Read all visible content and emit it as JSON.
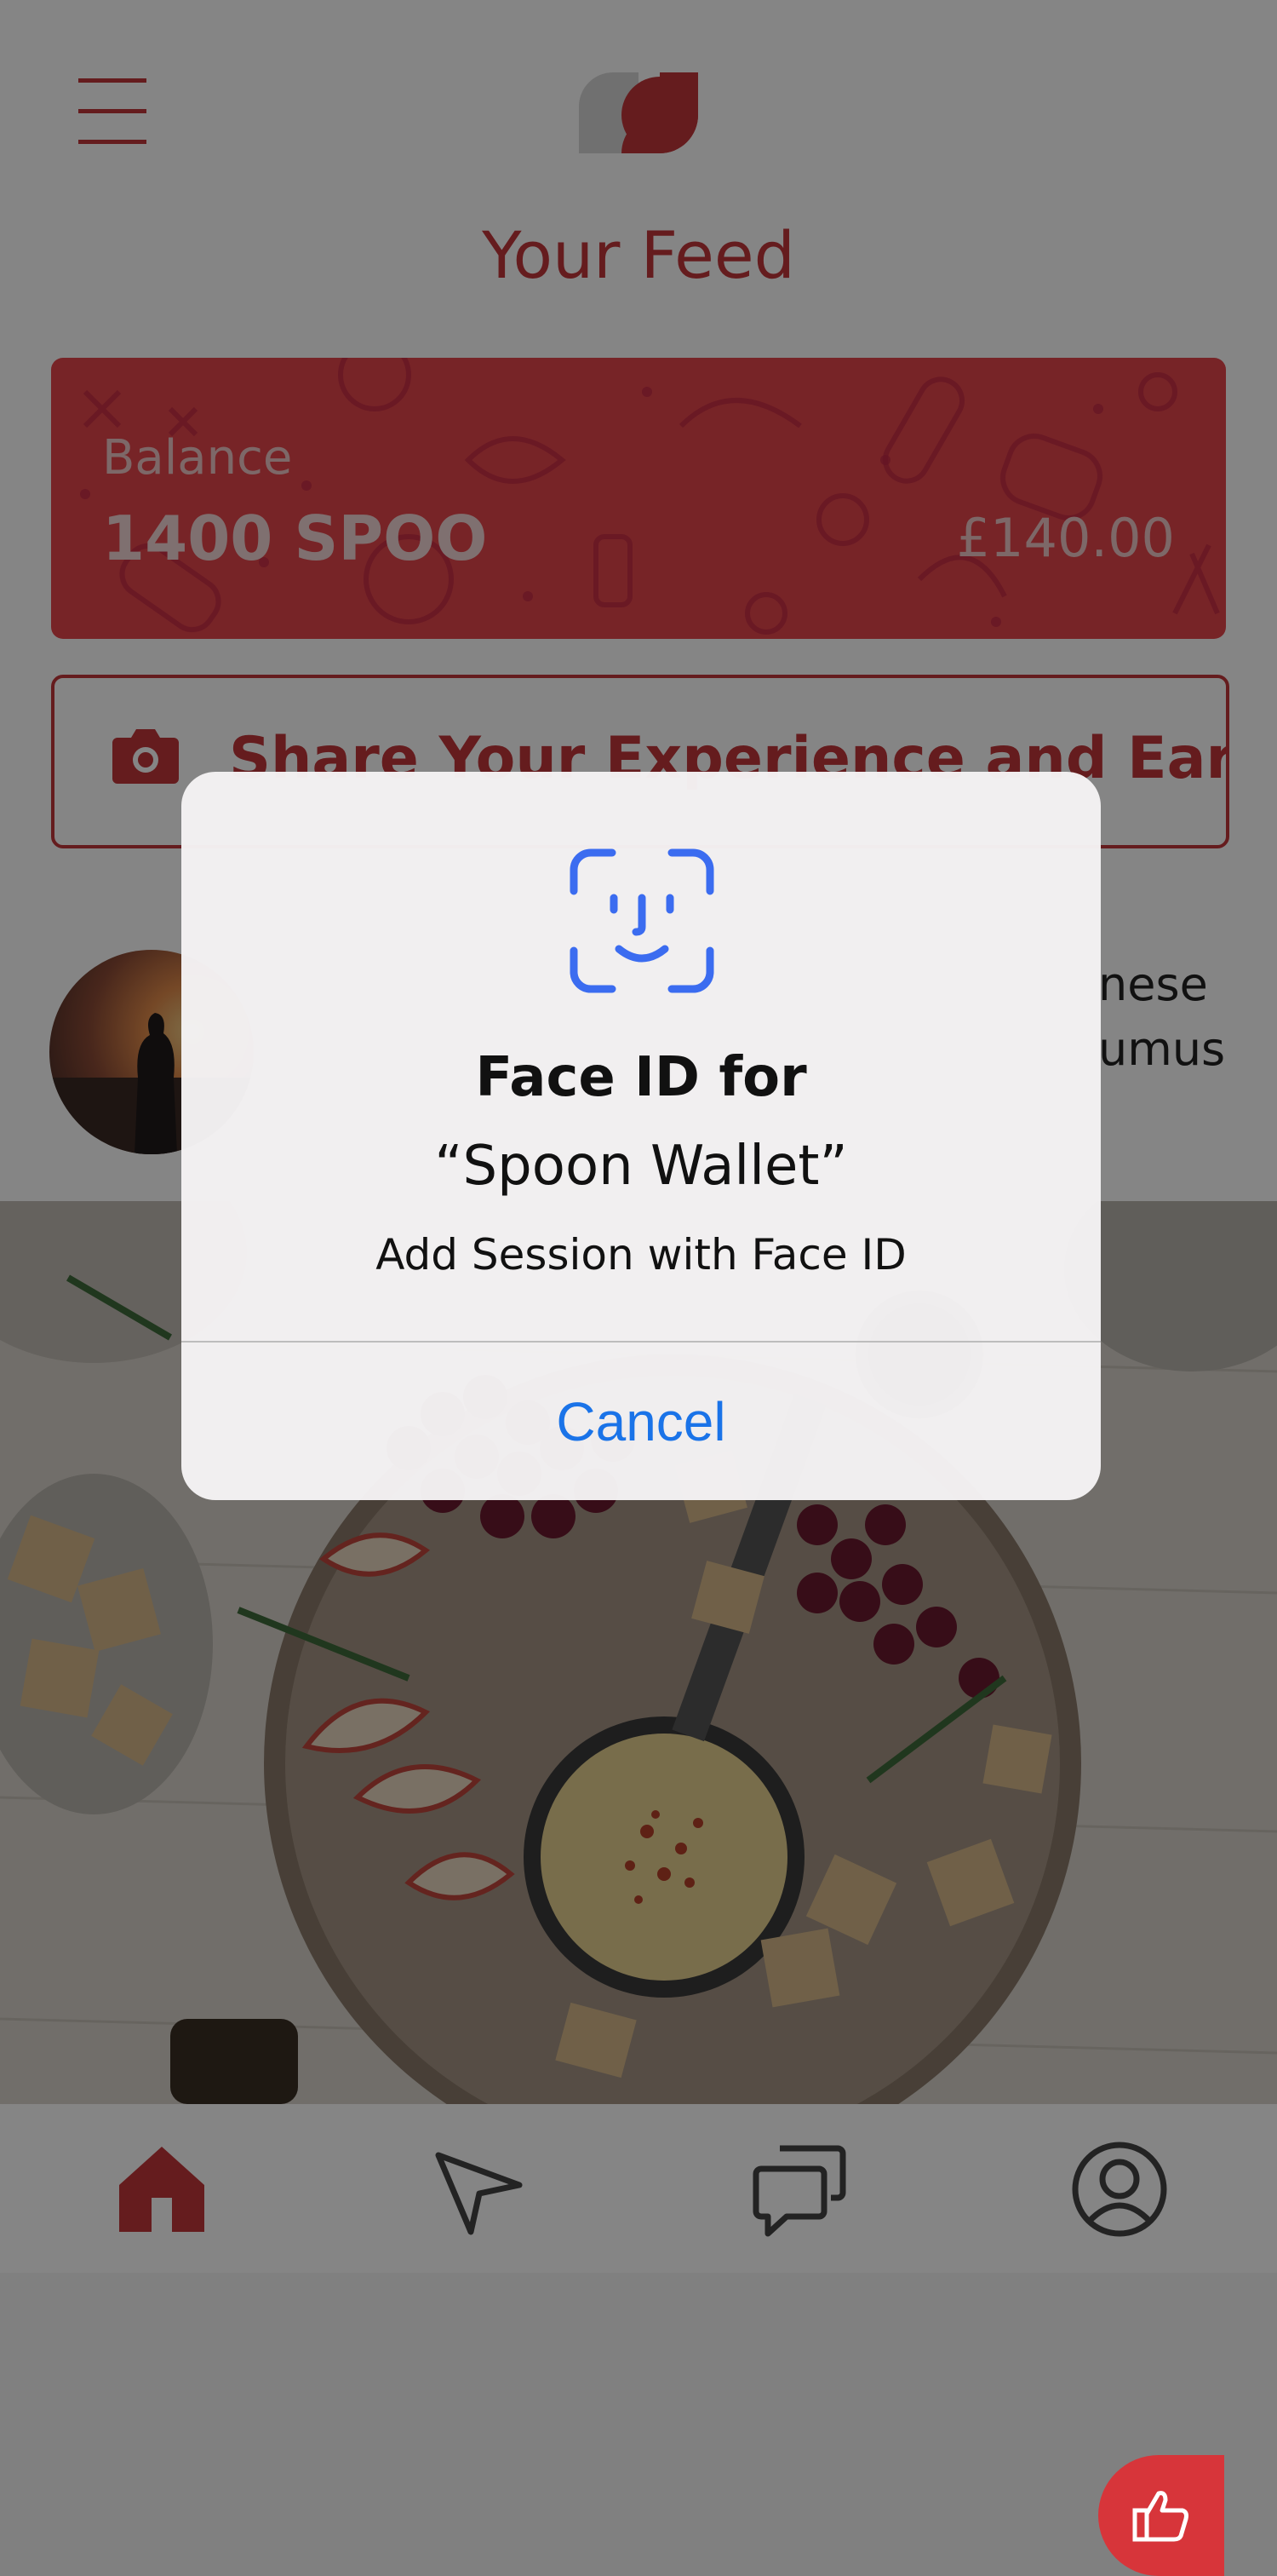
{
  "header": {
    "title": "Your Feed",
    "menu_icon": "hamburger-menu-icon",
    "logo_icon": "spoon-logo-icon"
  },
  "balance_card": {
    "label": "Balance",
    "amount": "1400 SPOO",
    "fiat": "£140.00"
  },
  "share_button": {
    "label": "Share Your Experience and Earn",
    "icon": "camera-icon"
  },
  "post": {
    "text_fragment_1": "nese",
    "text_fragment_2": "umus",
    "like_icon": "thumbs-up-icon"
  },
  "tab_bar": {
    "items": [
      {
        "icon": "home-icon"
      },
      {
        "icon": "navigation-arrow-icon"
      },
      {
        "icon": "chat-bubbles-icon"
      },
      {
        "icon": "profile-icon"
      }
    ]
  },
  "dialog": {
    "icon": "face-id-icon",
    "title": "Face ID for",
    "app_name": "“Spoon Wallet”",
    "message": "Add Session with Face ID",
    "cancel_label": "Cancel"
  },
  "colors": {
    "brand": "#c2373a",
    "card": "#e4454b",
    "dialog_action": "#1a73e8"
  }
}
